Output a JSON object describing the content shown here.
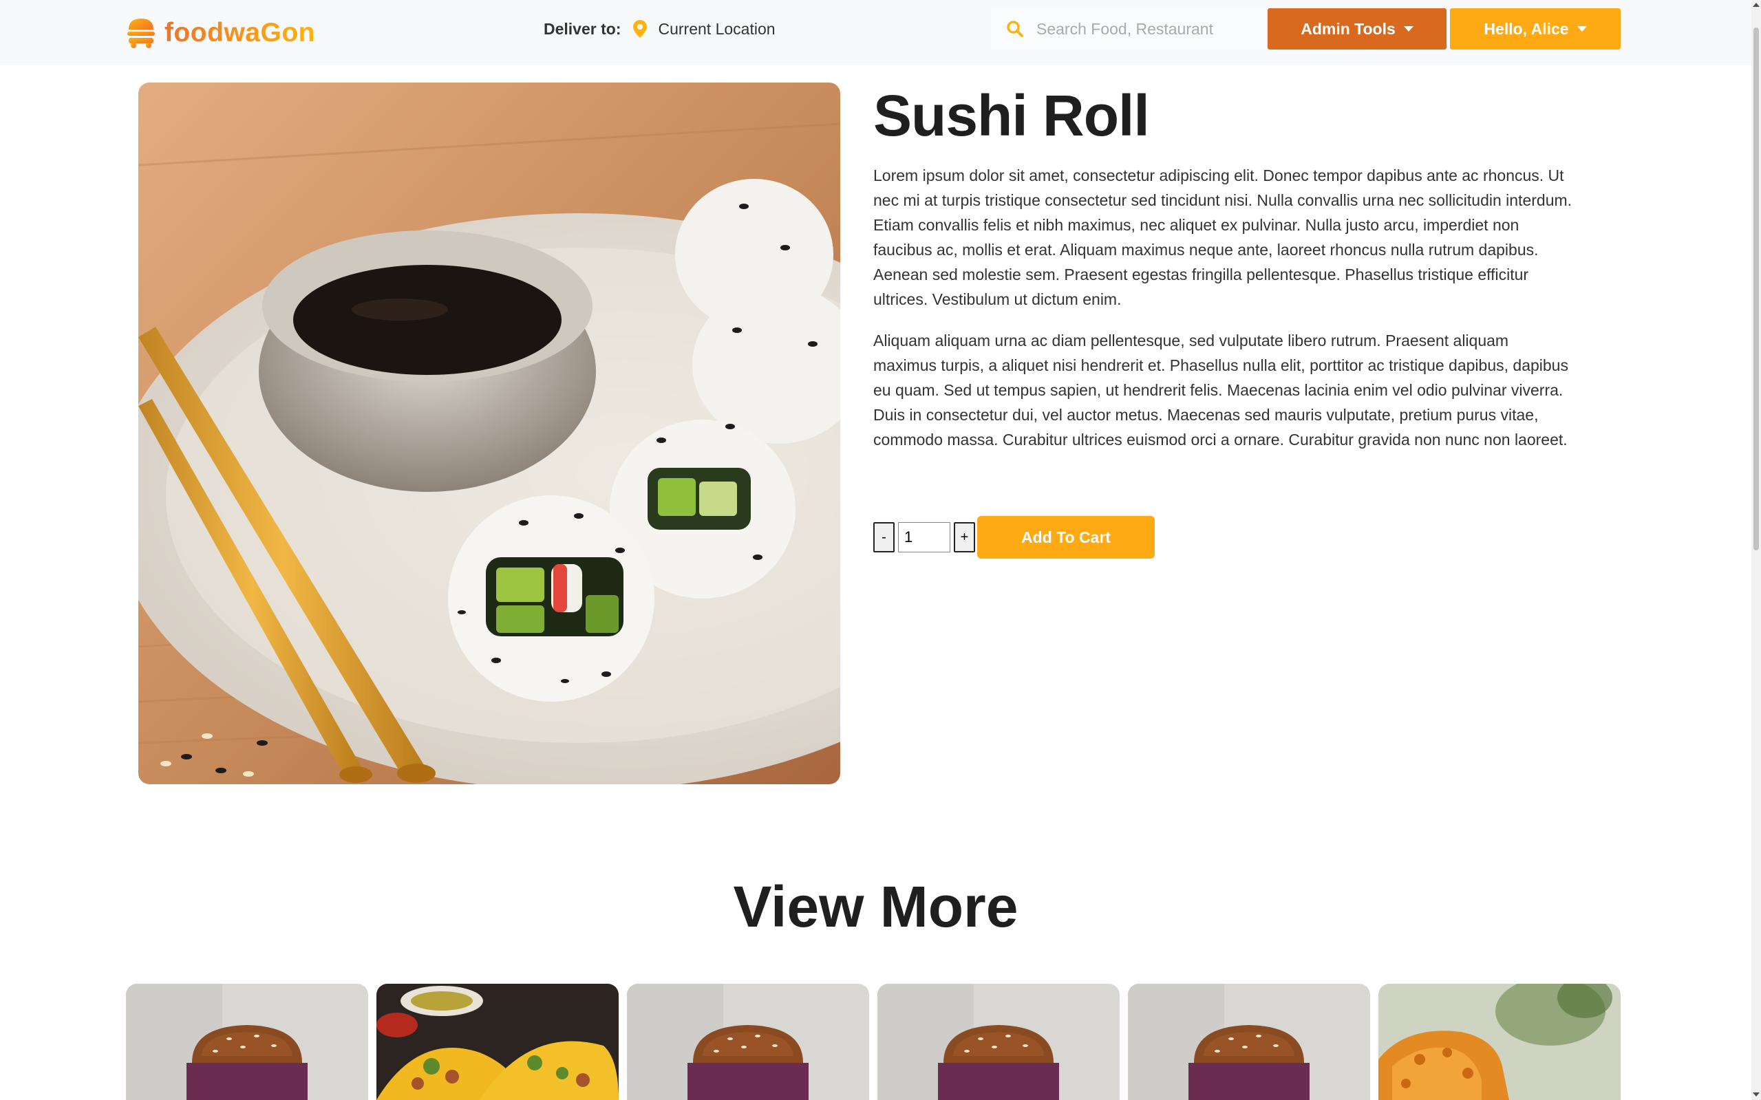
{
  "header": {
    "logo_text": "foodwaGon",
    "deliver_label": "Deliver to:",
    "deliver_value": "Current Location",
    "search_placeholder": "Search Food, Restaurant",
    "admin_label": "Admin Tools",
    "user_label": "Hello, Alice"
  },
  "product": {
    "title": "Sushi Roll",
    "description_1": "Lorem ipsum dolor sit amet, consectetur adipiscing elit. Donec tempor dapibus ante ac rhoncus. Ut nec mi at turpis tristique consectetur sed tincidunt nisi. Nulla convallis urna nec sollicitudin interdum. Etiam convallis felis et nibh maximus, nec aliquet ex pulvinar. Nulla justo arcu, imperdiet non faucibus ac, mollis et erat. Aliquam maximus neque ante, laoreet rhoncus nulla rutrum dapibus. Aenean sed molestie sem. Praesent egestas fringilla pellentesque. Phasellus tristique efficitur ultrices. Vestibulum ut dictum enim.",
    "description_2": "Aliquam aliquam urna ac diam pellentesque, sed vulputate libero rutrum. Praesent aliquam maximus turpis, a aliquet nisi hendrerit et. Phasellus nulla elit, porttitor ac tristique dapibus, dapibus eu quam. Sed ut tempus sapien, ut hendrerit felis. Maecenas lacinia enim vel odio pulvinar viverra. Duis in consectetur dui, vel auctor metus. Maecenas sed mauris vulputate, pretium purus vitae, commodo massa. Curabitur ultrices euismod orci a ornare. Curabitur gravida non nunc non laoreet.",
    "qty_minus": "-",
    "qty_value": "1",
    "qty_plus": "+",
    "add_to_cart": "Add To Cart"
  },
  "view_more": {
    "heading": "View More",
    "cards": [
      {
        "icon": "burger-image"
      },
      {
        "icon": "tacos-image"
      },
      {
        "icon": "burger-image"
      },
      {
        "icon": "burger-image"
      },
      {
        "icon": "burger-image"
      },
      {
        "icon": "fried-chicken-image"
      }
    ]
  },
  "colors": {
    "brand_orange": "#f17228",
    "brand_yellow": "#ffb30e",
    "admin_button": "#d8691f",
    "accent_button": "#ffa914"
  }
}
